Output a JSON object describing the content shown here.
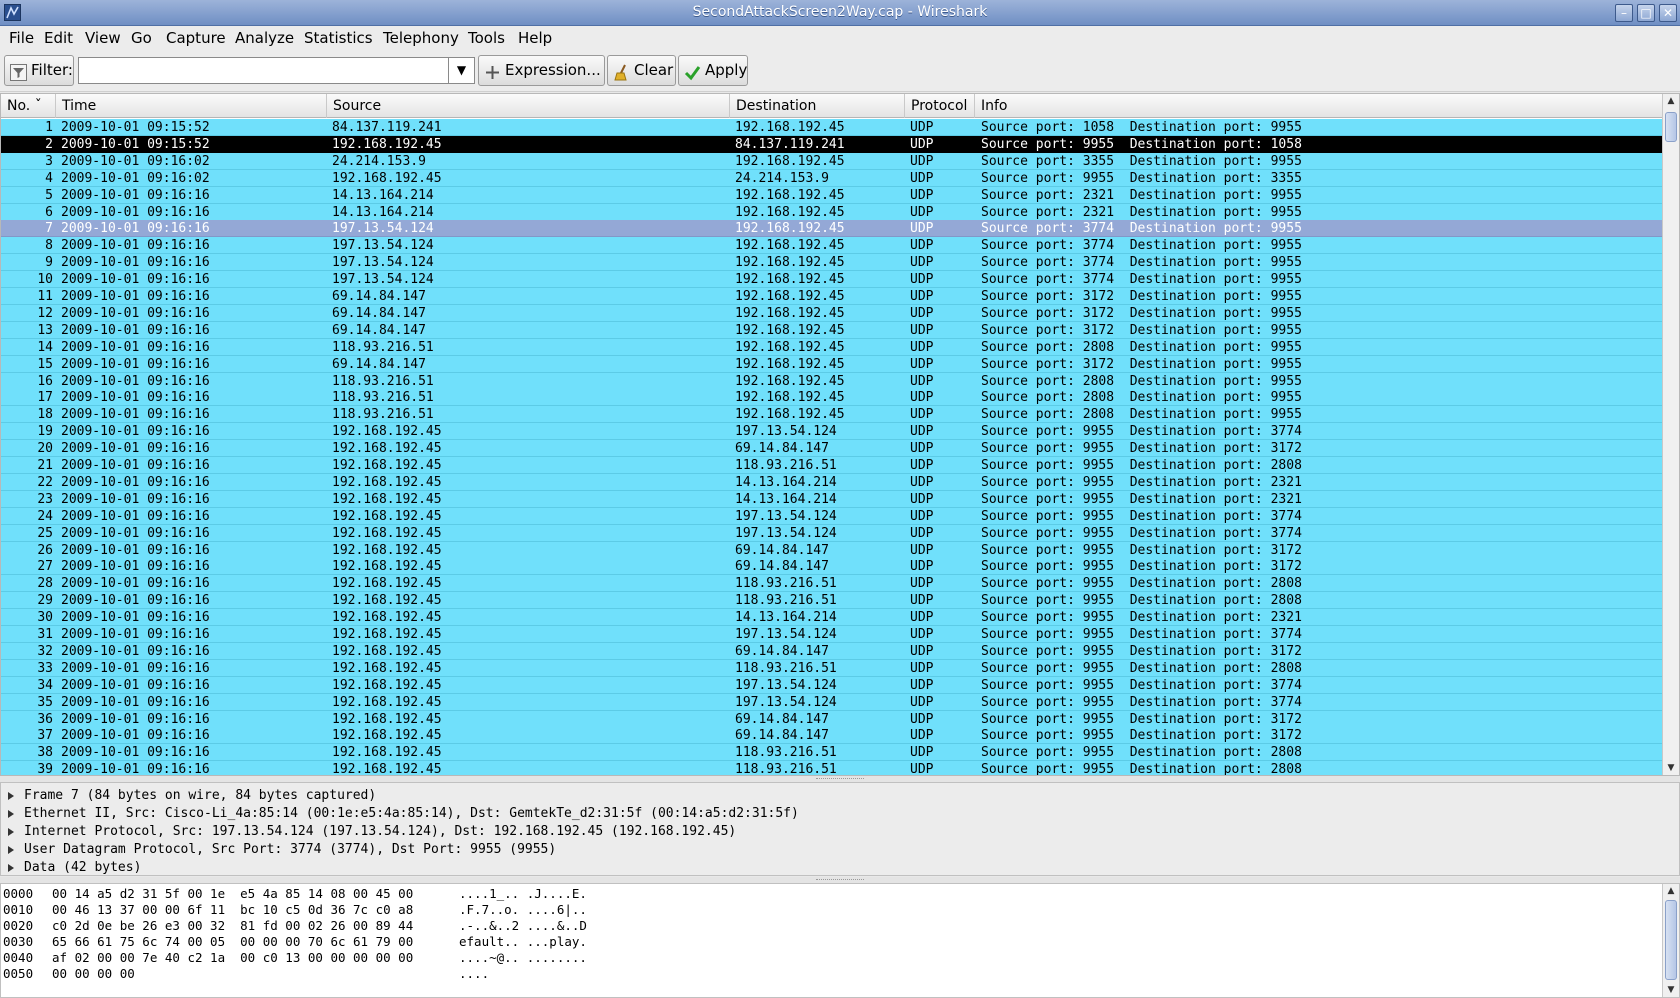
{
  "window": {
    "title": "SecondAttackScreen2Way.cap - Wireshark",
    "controls": {
      "minimize": "–",
      "maximize": "□",
      "close": "✕"
    }
  },
  "menu": [
    "File",
    "Edit",
    "View",
    "Go",
    "Capture",
    "Analyze",
    "Statistics",
    "Telephony",
    "Tools",
    "Help"
  ],
  "toolbar": {
    "filter_label": "Filter:",
    "filter_value": "",
    "expression_label": "Expression...",
    "clear_label": "Clear",
    "apply_label": "Apply"
  },
  "packet_list": {
    "columns": [
      "No. ˇ",
      "Time",
      "Source",
      "Destination",
      "Protocol",
      "Info"
    ],
    "rows": [
      {
        "no": "1",
        "time": "2009-10-01 09:15:52",
        "src": "84.137.119.241",
        "dst": "192.168.192.45",
        "proto": "UDP",
        "info": "Source port: 1058  Destination port: 9955"
      },
      {
        "no": "2",
        "time": "2009-10-01 09:15:52",
        "src": "192.168.192.45",
        "dst": "84.137.119.241",
        "proto": "UDP",
        "info": "Source port: 9955  Destination port: 1058"
      },
      {
        "no": "3",
        "time": "2009-10-01 09:16:02",
        "src": "24.214.153.9",
        "dst": "192.168.192.45",
        "proto": "UDP",
        "info": "Source port: 3355  Destination port: 9955"
      },
      {
        "no": "4",
        "time": "2009-10-01 09:16:02",
        "src": "192.168.192.45",
        "dst": "24.214.153.9",
        "proto": "UDP",
        "info": "Source port: 9955  Destination port: 3355"
      },
      {
        "no": "5",
        "time": "2009-10-01 09:16:16",
        "src": "14.13.164.214",
        "dst": "192.168.192.45",
        "proto": "UDP",
        "info": "Source port: 2321  Destination port: 9955"
      },
      {
        "no": "6",
        "time": "2009-10-01 09:16:16",
        "src": "14.13.164.214",
        "dst": "192.168.192.45",
        "proto": "UDP",
        "info": "Source port: 2321  Destination port: 9955"
      },
      {
        "no": "7",
        "time": "2009-10-01 09:16:16",
        "src": "197.13.54.124",
        "dst": "192.168.192.45",
        "proto": "UDP",
        "info": "Source port: 3774  Destination port: 9955"
      },
      {
        "no": "8",
        "time": "2009-10-01 09:16:16",
        "src": "197.13.54.124",
        "dst": "192.168.192.45",
        "proto": "UDP",
        "info": "Source port: 3774  Destination port: 9955"
      },
      {
        "no": "9",
        "time": "2009-10-01 09:16:16",
        "src": "197.13.54.124",
        "dst": "192.168.192.45",
        "proto": "UDP",
        "info": "Source port: 3774  Destination port: 9955"
      },
      {
        "no": "10",
        "time": "2009-10-01 09:16:16",
        "src": "197.13.54.124",
        "dst": "192.168.192.45",
        "proto": "UDP",
        "info": "Source port: 3774  Destination port: 9955"
      },
      {
        "no": "11",
        "time": "2009-10-01 09:16:16",
        "src": "69.14.84.147",
        "dst": "192.168.192.45",
        "proto": "UDP",
        "info": "Source port: 3172  Destination port: 9955"
      },
      {
        "no": "12",
        "time": "2009-10-01 09:16:16",
        "src": "69.14.84.147",
        "dst": "192.168.192.45",
        "proto": "UDP",
        "info": "Source port: 3172  Destination port: 9955"
      },
      {
        "no": "13",
        "time": "2009-10-01 09:16:16",
        "src": "69.14.84.147",
        "dst": "192.168.192.45",
        "proto": "UDP",
        "info": "Source port: 3172  Destination port: 9955"
      },
      {
        "no": "14",
        "time": "2009-10-01 09:16:16",
        "src": "118.93.216.51",
        "dst": "192.168.192.45",
        "proto": "UDP",
        "info": "Source port: 2808  Destination port: 9955"
      },
      {
        "no": "15",
        "time": "2009-10-01 09:16:16",
        "src": "69.14.84.147",
        "dst": "192.168.192.45",
        "proto": "UDP",
        "info": "Source port: 3172  Destination port: 9955"
      },
      {
        "no": "16",
        "time": "2009-10-01 09:16:16",
        "src": "118.93.216.51",
        "dst": "192.168.192.45",
        "proto": "UDP",
        "info": "Source port: 2808  Destination port: 9955"
      },
      {
        "no": "17",
        "time": "2009-10-01 09:16:16",
        "src": "118.93.216.51",
        "dst": "192.168.192.45",
        "proto": "UDP",
        "info": "Source port: 2808  Destination port: 9955"
      },
      {
        "no": "18",
        "time": "2009-10-01 09:16:16",
        "src": "118.93.216.51",
        "dst": "192.168.192.45",
        "proto": "UDP",
        "info": "Source port: 2808  Destination port: 9955"
      },
      {
        "no": "19",
        "time": "2009-10-01 09:16:16",
        "src": "192.168.192.45",
        "dst": "197.13.54.124",
        "proto": "UDP",
        "info": "Source port: 9955  Destination port: 3774"
      },
      {
        "no": "20",
        "time": "2009-10-01 09:16:16",
        "src": "192.168.192.45",
        "dst": "69.14.84.147",
        "proto": "UDP",
        "info": "Source port: 9955  Destination port: 3172"
      },
      {
        "no": "21",
        "time": "2009-10-01 09:16:16",
        "src": "192.168.192.45",
        "dst": "118.93.216.51",
        "proto": "UDP",
        "info": "Source port: 9955  Destination port: 2808"
      },
      {
        "no": "22",
        "time": "2009-10-01 09:16:16",
        "src": "192.168.192.45",
        "dst": "14.13.164.214",
        "proto": "UDP",
        "info": "Source port: 9955  Destination port: 2321"
      },
      {
        "no": "23",
        "time": "2009-10-01 09:16:16",
        "src": "192.168.192.45",
        "dst": "14.13.164.214",
        "proto": "UDP",
        "info": "Source port: 9955  Destination port: 2321"
      },
      {
        "no": "24",
        "time": "2009-10-01 09:16:16",
        "src": "192.168.192.45",
        "dst": "197.13.54.124",
        "proto": "UDP",
        "info": "Source port: 9955  Destination port: 3774"
      },
      {
        "no": "25",
        "time": "2009-10-01 09:16:16",
        "src": "192.168.192.45",
        "dst": "197.13.54.124",
        "proto": "UDP",
        "info": "Source port: 9955  Destination port: 3774"
      },
      {
        "no": "26",
        "time": "2009-10-01 09:16:16",
        "src": "192.168.192.45",
        "dst": "69.14.84.147",
        "proto": "UDP",
        "info": "Source port: 9955  Destination port: 3172"
      },
      {
        "no": "27",
        "time": "2009-10-01 09:16:16",
        "src": "192.168.192.45",
        "dst": "69.14.84.147",
        "proto": "UDP",
        "info": "Source port: 9955  Destination port: 3172"
      },
      {
        "no": "28",
        "time": "2009-10-01 09:16:16",
        "src": "192.168.192.45",
        "dst": "118.93.216.51",
        "proto": "UDP",
        "info": "Source port: 9955  Destination port: 2808"
      },
      {
        "no": "29",
        "time": "2009-10-01 09:16:16",
        "src": "192.168.192.45",
        "dst": "118.93.216.51",
        "proto": "UDP",
        "info": "Source port: 9955  Destination port: 2808"
      },
      {
        "no": "30",
        "time": "2009-10-01 09:16:16",
        "src": "192.168.192.45",
        "dst": "14.13.164.214",
        "proto": "UDP",
        "info": "Source port: 9955  Destination port: 2321"
      },
      {
        "no": "31",
        "time": "2009-10-01 09:16:16",
        "src": "192.168.192.45",
        "dst": "197.13.54.124",
        "proto": "UDP",
        "info": "Source port: 9955  Destination port: 3774"
      },
      {
        "no": "32",
        "time": "2009-10-01 09:16:16",
        "src": "192.168.192.45",
        "dst": "69.14.84.147",
        "proto": "UDP",
        "info": "Source port: 9955  Destination port: 3172"
      },
      {
        "no": "33",
        "time": "2009-10-01 09:16:16",
        "src": "192.168.192.45",
        "dst": "118.93.216.51",
        "proto": "UDP",
        "info": "Source port: 9955  Destination port: 2808"
      },
      {
        "no": "34",
        "time": "2009-10-01 09:16:16",
        "src": "192.168.192.45",
        "dst": "197.13.54.124",
        "proto": "UDP",
        "info": "Source port: 9955  Destination port: 3774"
      },
      {
        "no": "35",
        "time": "2009-10-01 09:16:16",
        "src": "192.168.192.45",
        "dst": "197.13.54.124",
        "proto": "UDP",
        "info": "Source port: 9955  Destination port: 3774"
      },
      {
        "no": "36",
        "time": "2009-10-01 09:16:16",
        "src": "192.168.192.45",
        "dst": "69.14.84.147",
        "proto": "UDP",
        "info": "Source port: 9955  Destination port: 3172"
      },
      {
        "no": "37",
        "time": "2009-10-01 09:16:16",
        "src": "192.168.192.45",
        "dst": "69.14.84.147",
        "proto": "UDP",
        "info": "Source port: 9955  Destination port: 3172"
      },
      {
        "no": "38",
        "time": "2009-10-01 09:16:16",
        "src": "192.168.192.45",
        "dst": "118.93.216.51",
        "proto": "UDP",
        "info": "Source port: 9955  Destination port: 2808"
      },
      {
        "no": "39",
        "time": "2009-10-01 09:16:16",
        "src": "192.168.192.45",
        "dst": "118.93.216.51",
        "proto": "UDP",
        "info": "Source port: 9955  Destination port: 2808"
      }
    ],
    "highlighted_row": "2",
    "selected_row": "7",
    "colors": {
      "udp_row": "#70e0fb",
      "black_row": "#000000",
      "selected_row": "#94a8d6"
    }
  },
  "details": [
    "Frame 7 (84 bytes on wire, 84 bytes captured)",
    "Ethernet II, Src: Cisco-Li_4a:85:14 (00:1e:e5:4a:85:14), Dst: GemtekTe_d2:31:5f (00:14:a5:d2:31:5f)",
    "Internet Protocol, Src: 197.13.54.124 (197.13.54.124), Dst: 192.168.192.45 (192.168.192.45)",
    "User Datagram Protocol, Src Port: 3774 (3774), Dst Port: 9955 (9955)",
    "Data (42 bytes)"
  ],
  "bytes": [
    {
      "off": "0000",
      "hex": "00 14 a5 d2 31 5f 00 1e  e5 4a 85 14 08 00 45 00",
      "ascii": "....1_.. .J....E."
    },
    {
      "off": "0010",
      "hex": "00 46 13 37 00 00 6f 11  bc 10 c5 0d 36 7c c0 a8",
      "ascii": ".F.7..o. ....6|.."
    },
    {
      "off": "0020",
      "hex": "c0 2d 0e be 26 e3 00 32  81 fd 00 02 26 00 89 44",
      "ascii": ".-..&..2 ....&..D"
    },
    {
      "off": "0030",
      "hex": "65 66 61 75 6c 74 00 05  00 00 00 70 6c 61 79 00",
      "ascii": "efault.. ...play."
    },
    {
      "off": "0040",
      "hex": "af 02 00 00 7e 40 c2 1a  00 c0 13 00 00 00 00 00",
      "ascii": "....~@.. ........"
    },
    {
      "off": "0050",
      "hex": "00 00 00 00",
      "ascii": "...."
    }
  ]
}
